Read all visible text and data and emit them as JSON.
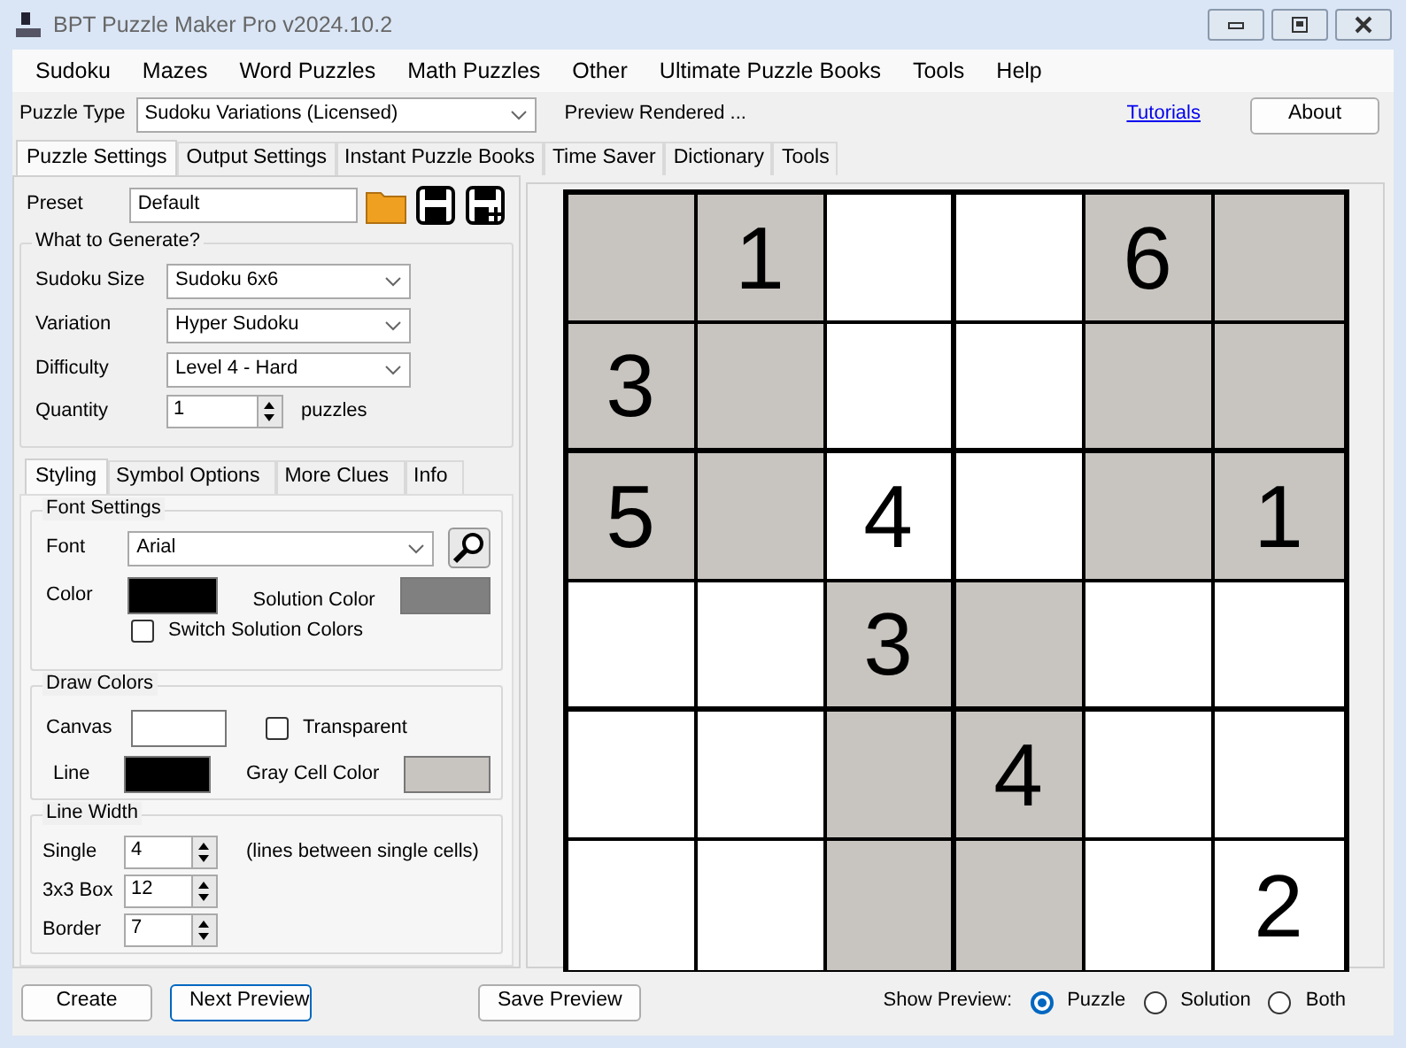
{
  "window": {
    "title": "BPT Puzzle Maker Pro v2024.10.2"
  },
  "menu": [
    "Sudoku",
    "Mazes",
    "Word Puzzles",
    "Math Puzzles",
    "Other",
    "Ultimate Puzzle Books",
    "Tools",
    "Help"
  ],
  "puzzle_type": {
    "label": "Puzzle Type",
    "value": "Sudoku Variations (Licensed)"
  },
  "status": "Preview Rendered ...",
  "tutorials_link": "Tutorials",
  "about_button": "About",
  "main_tabs": [
    {
      "label": "Puzzle Settings",
      "selected": true
    },
    {
      "label": "Output Settings",
      "selected": false
    },
    {
      "label": "Instant Puzzle Books",
      "selected": false
    },
    {
      "label": "Time Saver",
      "selected": false
    },
    {
      "label": "Dictionary",
      "selected": false
    },
    {
      "label": "Tools",
      "selected": false
    }
  ],
  "preset": {
    "label": "Preset",
    "value": "Default"
  },
  "generate": {
    "title": "What to Generate?",
    "fields": [
      {
        "label": "Sudoku Size",
        "value": "Sudoku  6x6"
      },
      {
        "label": "Variation",
        "value": "Hyper Sudoku"
      },
      {
        "label": "Difficulty",
        "value": "Level 4 - Hard"
      }
    ],
    "quantity": {
      "label": "Quantity",
      "value": "1",
      "unit": "puzzles"
    }
  },
  "sub_tabs": [
    {
      "label": "Styling",
      "selected": true
    },
    {
      "label": "Symbol Options",
      "selected": false
    },
    {
      "label": "More Clues",
      "selected": false
    },
    {
      "label": "Info",
      "selected": false
    }
  ],
  "font_settings": {
    "title": "Font Settings",
    "font_label": "Font",
    "font_value": "Arial",
    "swatches": [
      {
        "label": "Color",
        "color": "#000000"
      },
      {
        "label": "Solution Color",
        "color": "#808080"
      }
    ],
    "switch": {
      "label": "Switch Solution Colors",
      "checked": false
    }
  },
  "draw_colors": {
    "title": "Draw Colors",
    "swatches": [
      {
        "label": "Canvas",
        "color": "#ffffff"
      },
      {
        "label": "Line",
        "color": "#000000"
      },
      {
        "label": "Gray Cell Color",
        "color": "#c8c4c0"
      }
    ],
    "transparent": {
      "label": "Transparent",
      "checked": false
    }
  },
  "line_width": {
    "title": "Line Width",
    "rows": [
      {
        "label": "Single",
        "value": "4",
        "note": "(lines between single cells)"
      },
      {
        "label": "3x3 Box",
        "value": "12"
      },
      {
        "label": "Border",
        "value": "7"
      }
    ]
  },
  "puzzle": {
    "rows": [
      [
        {
          "shaded": true
        },
        {
          "value": "1",
          "shaded": true
        },
        {
          "shaded": false
        },
        {
          "shaded": false
        },
        {
          "value": "6",
          "shaded": true
        },
        {
          "shaded": true
        }
      ],
      [
        {
          "value": "3",
          "shaded": true
        },
        {
          "shaded": true
        },
        {
          "shaded": false
        },
        {
          "shaded": false
        },
        {
          "shaded": true
        },
        {
          "shaded": true
        }
      ],
      [
        {
          "value": "5",
          "shaded": true
        },
        {
          "shaded": true
        },
        {
          "value": "4",
          "shaded": false
        },
        {
          "shaded": false
        },
        {
          "shaded": true
        },
        {
          "value": "1",
          "shaded": true
        }
      ],
      [
        {
          "shaded": false
        },
        {
          "shaded": false
        },
        {
          "value": "3",
          "shaded": true
        },
        {
          "shaded": true
        },
        {
          "shaded": false
        },
        {
          "shaded": false
        }
      ],
      [
        {
          "shaded": false
        },
        {
          "shaded": false
        },
        {
          "shaded": true
        },
        {
          "value": "4",
          "shaded": true
        },
        {
          "shaded": false
        },
        {
          "shaded": false
        }
      ],
      [
        {
          "shaded": false
        },
        {
          "shaded": false
        },
        {
          "shaded": true
        },
        {
          "shaded": true
        },
        {
          "shaded": false
        },
        {
          "value": "2",
          "shaded": false
        }
      ]
    ]
  },
  "bottom_buttons": [
    {
      "label": "Create",
      "focused": false
    },
    {
      "label": "Next Preview",
      "focused": true
    }
  ],
  "save_preview_button": "Save Preview",
  "show_preview": {
    "label": "Show Preview:",
    "options": [
      {
        "label": "Puzzle",
        "selected": true
      },
      {
        "label": "Solution",
        "selected": false
      },
      {
        "label": "Both",
        "selected": false
      }
    ]
  }
}
